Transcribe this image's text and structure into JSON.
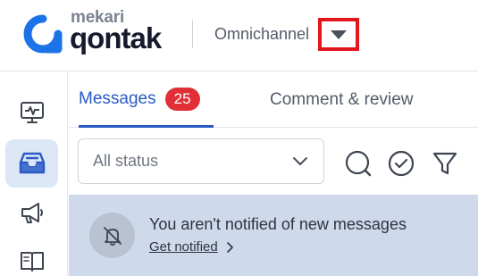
{
  "header": {
    "brand_top": "mekari",
    "brand_main": "qontak",
    "product": "Omnichannel"
  },
  "sidebar": {
    "items": [
      {
        "icon": "monitor-pulse-icon",
        "active": false
      },
      {
        "icon": "inbox-icon",
        "active": true
      },
      {
        "icon": "megaphone-icon",
        "active": false
      },
      {
        "icon": "book-icon",
        "active": false
      }
    ]
  },
  "tabs": {
    "messages_label": "Messages",
    "messages_count": "25",
    "comments_label": "Comment & review"
  },
  "filter": {
    "status_value": "All status",
    "icons": [
      "search-icon",
      "check-circle-icon",
      "filter-icon"
    ]
  },
  "notice": {
    "title": "You aren't notified of new messages",
    "link": "Get notified"
  },
  "colors": {
    "accent": "#2a5ac5",
    "badge": "#e02f37",
    "highlight": "#e3161e",
    "notice_bg": "#ced9eb"
  }
}
